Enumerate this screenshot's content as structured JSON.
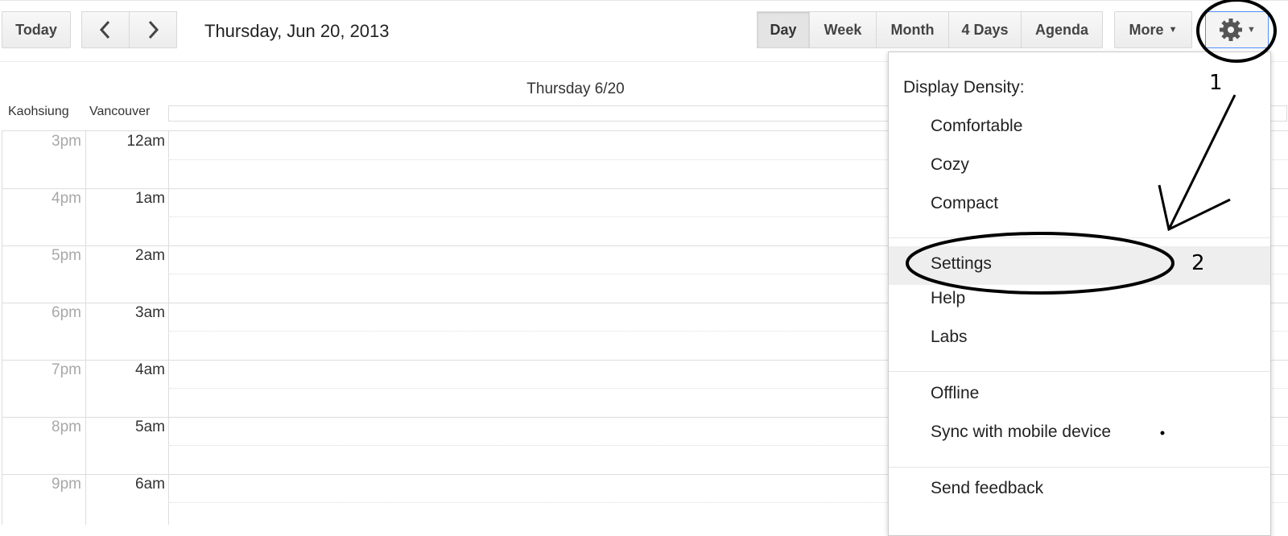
{
  "toolbar": {
    "today_label": "Today",
    "date_title": "Thursday, Jun 20, 2013",
    "views": [
      "Day",
      "Week",
      "Month",
      "4 Days",
      "Agenda"
    ],
    "active_view": "Day",
    "more_label": "More"
  },
  "calendar": {
    "day_header": "Thursday 6/20",
    "tz_primary": "Kaohsiung",
    "tz_secondary": "Vancouver",
    "rows": [
      {
        "k": "3pm",
        "v": "12am"
      },
      {
        "k": "4pm",
        "v": "1am"
      },
      {
        "k": "5pm",
        "v": "2am"
      },
      {
        "k": "6pm",
        "v": "3am"
      },
      {
        "k": "7pm",
        "v": "4am"
      },
      {
        "k": "8pm",
        "v": "5am"
      },
      {
        "k": "9pm",
        "v": "6am"
      }
    ]
  },
  "menu": {
    "density_header": "Display Density:",
    "density_options": [
      "Comfortable",
      "Cozy",
      "Compact"
    ],
    "settings": "Settings",
    "help": "Help",
    "labs": "Labs",
    "offline": "Offline",
    "sync": "Sync with mobile device",
    "feedback": "Send feedback"
  },
  "annotations": {
    "step1": "1",
    "step2": "2"
  }
}
